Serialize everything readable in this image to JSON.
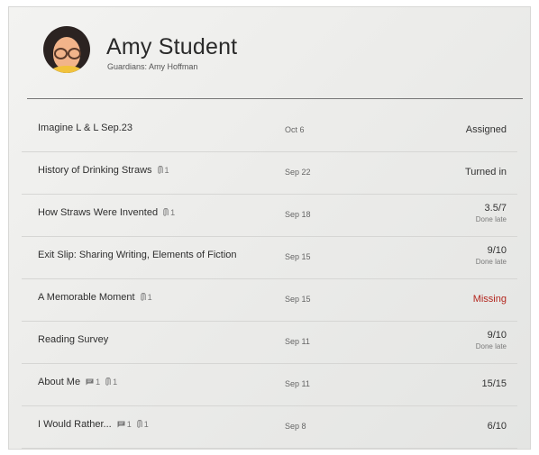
{
  "student": {
    "name": "Amy Student",
    "guardians": "Guardians: Amy Hoffman"
  },
  "colors": {
    "missing": "#b3261e",
    "text": "#2f2f2f",
    "muted": "#777777"
  },
  "assignments": [
    {
      "title": "Imagine L & L Sep.23",
      "attachments": "",
      "comments": "",
      "date": "Oct 6",
      "status": "Assigned",
      "status_note": ""
    },
    {
      "title": "History of Drinking Straws",
      "attachments": "1",
      "comments": "",
      "date": "Sep 22",
      "status": "Turned in",
      "status_note": ""
    },
    {
      "title": "How Straws Were Invented",
      "attachments": "1",
      "comments": "",
      "date": "Sep 18",
      "status": "3.5/7",
      "status_note": "Done late"
    },
    {
      "title": "Exit Slip: Sharing Writing, Elements of Fiction",
      "attachments": "",
      "comments": "",
      "date": "Sep 15",
      "status": "9/10",
      "status_note": "Done late"
    },
    {
      "title": "A Memorable Moment",
      "attachments": "1",
      "comments": "",
      "date": "Sep 15",
      "status": "Missing",
      "status_note": ""
    },
    {
      "title": "Reading Survey",
      "attachments": "",
      "comments": "",
      "date": "Sep 11",
      "status": "9/10",
      "status_note": "Done late"
    },
    {
      "title": "About Me",
      "attachments": "1",
      "comments": "1",
      "date": "Sep 11",
      "status": "15/15",
      "status_note": ""
    },
    {
      "title": "I Would Rather...",
      "attachments": "1",
      "comments": "1",
      "date": "Sep 8",
      "status": "6/10",
      "status_note": ""
    }
  ]
}
